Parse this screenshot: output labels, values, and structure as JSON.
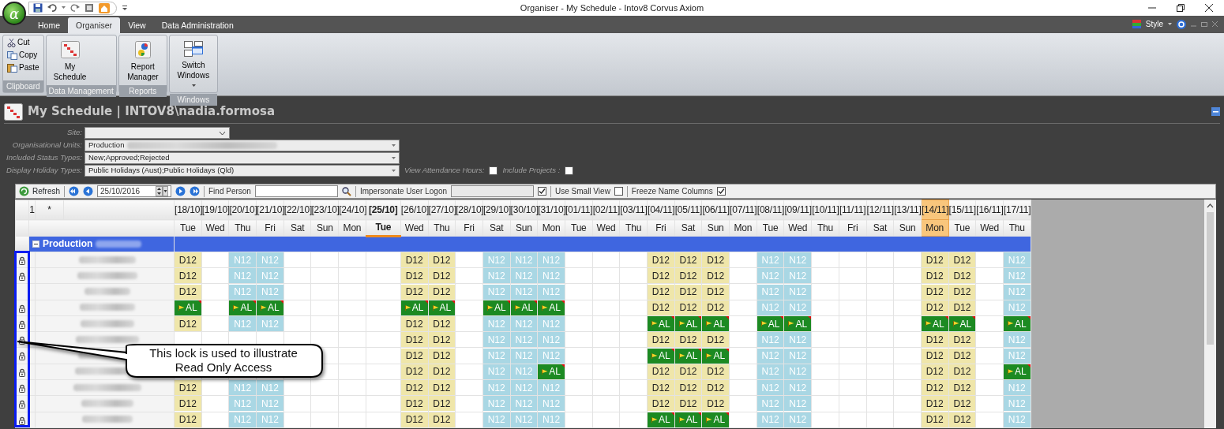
{
  "window": {
    "title": "Organiser - My Schedule - Intov8 Corvus Axiom",
    "logo": "α"
  },
  "ribbon_tabs": [
    {
      "label": "Home",
      "selected": false
    },
    {
      "label": "Organiser",
      "selected": true
    },
    {
      "label": "View",
      "selected": false
    },
    {
      "label": "Data Administration",
      "selected": false
    }
  ],
  "style_menu": {
    "label": "Style"
  },
  "ribbon_groups": [
    {
      "label": "Clipboard",
      "kind": "small",
      "buttons": [
        {
          "label": "Cut"
        },
        {
          "label": "Copy"
        },
        {
          "label": "Paste"
        }
      ]
    },
    {
      "label": "Data Management",
      "kind": "large",
      "buttons": [
        {
          "label": "My Schedule",
          "dropdown": false
        }
      ]
    },
    {
      "label": "Reports",
      "kind": "large",
      "buttons": [
        {
          "label": "Report Manager",
          "dropdown": false
        }
      ]
    },
    {
      "label": "Windows",
      "kind": "large",
      "buttons": [
        {
          "label": "Switch Windows",
          "dropdown": true
        }
      ]
    }
  ],
  "view": {
    "title": "My Schedule | INTOV8\\nadia.formosa"
  },
  "filters": [
    {
      "label": "Site:",
      "kind": "short"
    },
    {
      "label": "Organisational Units:",
      "kind": "long",
      "value": "Production",
      "redacted": true
    },
    {
      "label": "Included Status Types:",
      "kind": "long",
      "value": "New;Approved;Rejected",
      "redacted": false
    },
    {
      "label": "Display Holiday Types:",
      "kind": "long",
      "value": "Public Holidays (Aust);Public Holidays (Qld)",
      "redacted": false
    }
  ],
  "filter_options": [
    {
      "label": "View Attendance Hours:",
      "checked": false
    },
    {
      "label": "Include Projects :",
      "checked": false
    }
  ],
  "toolbar": {
    "refresh": "Refresh",
    "date": "25/10/2016",
    "find_label": "Find Person",
    "impersonate_label": "Impersonate User Logon",
    "impersonate_checked": true,
    "options": [
      {
        "label": "Use Small View",
        "checked": false
      },
      {
        "label": "Freeze Name Columns",
        "checked": true
      }
    ]
  },
  "grid": {
    "header_marks": [
      "1",
      "*"
    ],
    "columns": [
      {
        "date": "[18/10]",
        "day": "Tue",
        "today": false,
        "highlighted": false
      },
      {
        "date": "[19/10]",
        "day": "Wed",
        "today": false,
        "highlighted": false
      },
      {
        "date": "[20/10]",
        "day": "Thu",
        "today": false,
        "highlighted": false
      },
      {
        "date": "[21/10]",
        "day": "Fri",
        "today": false,
        "highlighted": false
      },
      {
        "date": "[22/10]",
        "day": "Sat",
        "today": false,
        "highlighted": false
      },
      {
        "date": "[23/10]",
        "day": "Sun",
        "today": false,
        "highlighted": false
      },
      {
        "date": "[24/10]",
        "day": "Mon",
        "today": false,
        "highlighted": false
      },
      {
        "date": "[25/10]",
        "day": "Tue",
        "today": true,
        "highlighted": false
      },
      {
        "date": "[26/10]",
        "day": "Wed",
        "today": false,
        "highlighted": false
      },
      {
        "date": "[27/10]",
        "day": "Thu",
        "today": false,
        "highlighted": false
      },
      {
        "date": "[28/10]",
        "day": "Fri",
        "today": false,
        "highlighted": false
      },
      {
        "date": "[29/10]",
        "day": "Sat",
        "today": false,
        "highlighted": false
      },
      {
        "date": "[30/10]",
        "day": "Sun",
        "today": false,
        "highlighted": false
      },
      {
        "date": "[31/10]",
        "day": "Mon",
        "today": false,
        "highlighted": false
      },
      {
        "date": "[01/11]",
        "day": "Tue",
        "today": false,
        "highlighted": false
      },
      {
        "date": "[02/11]",
        "day": "Wed",
        "today": false,
        "highlighted": false
      },
      {
        "date": "[03/11]",
        "day": "Thu",
        "today": false,
        "highlighted": false
      },
      {
        "date": "[04/11]",
        "day": "Fri",
        "today": false,
        "highlighted": false
      },
      {
        "date": "[05/11]",
        "day": "Sat",
        "today": false,
        "highlighted": false
      },
      {
        "date": "[06/11]",
        "day": "Sun",
        "today": false,
        "highlighted": false
      },
      {
        "date": "[07/11]",
        "day": "Mon",
        "today": false,
        "highlighted": false
      },
      {
        "date": "[08/11]",
        "day": "Tue",
        "today": false,
        "highlighted": false
      },
      {
        "date": "[09/11]",
        "day": "Wed",
        "today": false,
        "highlighted": false
      },
      {
        "date": "[10/11]",
        "day": "Thu",
        "today": false,
        "highlighted": false
      },
      {
        "date": "[11/11]",
        "day": "Fri",
        "today": false,
        "highlighted": false
      },
      {
        "date": "[12/11]",
        "day": "Sat",
        "today": false,
        "highlighted": false
      },
      {
        "date": "[13/11]",
        "day": "Sun",
        "today": false,
        "highlighted": false
      },
      {
        "date": "[14/11]",
        "day": "Mon",
        "today": false,
        "highlighted": true
      },
      {
        "date": "[15/11]",
        "day": "Tue",
        "today": false,
        "highlighted": false
      },
      {
        "date": "[16/11]",
        "day": "Wed",
        "today": false,
        "highlighted": false
      },
      {
        "date": "[17/11]",
        "day": "Thu",
        "today": false,
        "highlighted": false
      }
    ],
    "group": {
      "label": "Production",
      "expanded": true
    },
    "rows": [
      {
        "locked": true,
        "cells": [
          {
            "kind": "day",
            "text": "D12"
          },
          {
            "kind": "blank"
          },
          {
            "kind": "night",
            "text": "N12"
          },
          {
            "kind": "night",
            "text": "N12"
          },
          {
            "kind": "blank"
          },
          {
            "kind": "blank"
          },
          {
            "kind": "blank"
          },
          {
            "kind": "blank"
          },
          {
            "kind": "day",
            "text": "D12"
          },
          {
            "kind": "day",
            "text": "D12"
          },
          {
            "kind": "blank"
          },
          {
            "kind": "night",
            "text": "N12"
          },
          {
            "kind": "night",
            "text": "N12"
          },
          {
            "kind": "night",
            "text": "N12"
          },
          {
            "kind": "blank"
          },
          {
            "kind": "blank"
          },
          {
            "kind": "blank"
          },
          {
            "kind": "day",
            "text": "D12"
          },
          {
            "kind": "day",
            "text": "D12"
          },
          {
            "kind": "day",
            "text": "D12"
          },
          {
            "kind": "blank"
          },
          {
            "kind": "night",
            "text": "N12"
          },
          {
            "kind": "night",
            "text": "N12"
          },
          {
            "kind": "blank"
          },
          {
            "kind": "blank"
          },
          {
            "kind": "blank"
          },
          {
            "kind": "blank"
          },
          {
            "kind": "day",
            "text": "D12"
          },
          {
            "kind": "day",
            "text": "D12"
          },
          {
            "kind": "blank"
          },
          {
            "kind": "night",
            "text": "N12"
          }
        ]
      },
      {
        "locked": true,
        "cells": [
          {
            "kind": "day",
            "text": "D12"
          },
          {
            "kind": "blank"
          },
          {
            "kind": "night",
            "text": "N12"
          },
          {
            "kind": "night",
            "text": "N12"
          },
          {
            "kind": "blank"
          },
          {
            "kind": "blank"
          },
          {
            "kind": "blank"
          },
          {
            "kind": "blank"
          },
          {
            "kind": "day",
            "text": "D12"
          },
          {
            "kind": "day",
            "text": "D12"
          },
          {
            "kind": "blank"
          },
          {
            "kind": "night",
            "text": "N12"
          },
          {
            "kind": "night",
            "text": "N12"
          },
          {
            "kind": "night",
            "text": "N12"
          },
          {
            "kind": "blank"
          },
          {
            "kind": "blank"
          },
          {
            "kind": "blank"
          },
          {
            "kind": "day",
            "text": "D12"
          },
          {
            "kind": "day",
            "text": "D12"
          },
          {
            "kind": "day",
            "text": "D12"
          },
          {
            "kind": "blank"
          },
          {
            "kind": "night",
            "text": "N12"
          },
          {
            "kind": "night",
            "text": "N12"
          },
          {
            "kind": "blank"
          },
          {
            "kind": "blank"
          },
          {
            "kind": "blank"
          },
          {
            "kind": "blank"
          },
          {
            "kind": "day",
            "text": "D12"
          },
          {
            "kind": "day",
            "text": "D12"
          },
          {
            "kind": "blank"
          },
          {
            "kind": "night",
            "text": "N12"
          }
        ]
      },
      {
        "locked": false,
        "cells": [
          {
            "kind": "day",
            "text": "D12"
          },
          {
            "kind": "blank"
          },
          {
            "kind": "night",
            "text": "N12"
          },
          {
            "kind": "night",
            "text": "N12"
          },
          {
            "kind": "blank"
          },
          {
            "kind": "blank"
          },
          {
            "kind": "blank"
          },
          {
            "kind": "blank"
          },
          {
            "kind": "day",
            "text": "D12"
          },
          {
            "kind": "day",
            "text": "D12"
          },
          {
            "kind": "blank"
          },
          {
            "kind": "night",
            "text": "N12"
          },
          {
            "kind": "night",
            "text": "N12"
          },
          {
            "kind": "night",
            "text": "N12"
          },
          {
            "kind": "blank"
          },
          {
            "kind": "blank"
          },
          {
            "kind": "blank"
          },
          {
            "kind": "day",
            "text": "D12"
          },
          {
            "kind": "day",
            "text": "D12"
          },
          {
            "kind": "day",
            "text": "D12"
          },
          {
            "kind": "blank"
          },
          {
            "kind": "night",
            "text": "N12"
          },
          {
            "kind": "night",
            "text": "N12"
          },
          {
            "kind": "blank"
          },
          {
            "kind": "blank"
          },
          {
            "kind": "blank"
          },
          {
            "kind": "blank"
          },
          {
            "kind": "day",
            "text": "D12"
          },
          {
            "kind": "day",
            "text": "D12"
          },
          {
            "kind": "blank"
          },
          {
            "kind": "night",
            "text": "N12"
          }
        ]
      },
      {
        "locked": true,
        "cells": [
          {
            "kind": "leave",
            "text": "AL"
          },
          {
            "kind": "blank"
          },
          {
            "kind": "leave",
            "text": "AL"
          },
          {
            "kind": "leave",
            "text": "AL"
          },
          {
            "kind": "blank"
          },
          {
            "kind": "blank"
          },
          {
            "kind": "blank"
          },
          {
            "kind": "blank"
          },
          {
            "kind": "leave",
            "text": "AL"
          },
          {
            "kind": "leave",
            "text": "AL"
          },
          {
            "kind": "blank"
          },
          {
            "kind": "leave",
            "text": "AL"
          },
          {
            "kind": "leave",
            "text": "AL"
          },
          {
            "kind": "leave",
            "text": "AL"
          },
          {
            "kind": "blank"
          },
          {
            "kind": "blank"
          },
          {
            "kind": "blank"
          },
          {
            "kind": "day",
            "text": "D12"
          },
          {
            "kind": "day",
            "text": "D12"
          },
          {
            "kind": "day",
            "text": "D12"
          },
          {
            "kind": "blank"
          },
          {
            "kind": "night",
            "text": "N12"
          },
          {
            "kind": "night",
            "text": "N12"
          },
          {
            "kind": "blank"
          },
          {
            "kind": "blank"
          },
          {
            "kind": "blank"
          },
          {
            "kind": "blank"
          },
          {
            "kind": "day",
            "text": "D12"
          },
          {
            "kind": "day",
            "text": "D12"
          },
          {
            "kind": "blank"
          },
          {
            "kind": "night",
            "text": "N12"
          }
        ]
      },
      {
        "locked": true,
        "cells": [
          {
            "kind": "day",
            "text": "D12"
          },
          {
            "kind": "blank"
          },
          {
            "kind": "night",
            "text": "N12"
          },
          {
            "kind": "night",
            "text": "N12"
          },
          {
            "kind": "blank"
          },
          {
            "kind": "blank"
          },
          {
            "kind": "blank"
          },
          {
            "kind": "blank"
          },
          {
            "kind": "day",
            "text": "D12"
          },
          {
            "kind": "day",
            "text": "D12"
          },
          {
            "kind": "blank"
          },
          {
            "kind": "night",
            "text": "N12"
          },
          {
            "kind": "night",
            "text": "N12"
          },
          {
            "kind": "night",
            "text": "N12"
          },
          {
            "kind": "blank"
          },
          {
            "kind": "blank"
          },
          {
            "kind": "blank"
          },
          {
            "kind": "leave",
            "text": "AL"
          },
          {
            "kind": "leave",
            "text": "AL"
          },
          {
            "kind": "leave",
            "text": "AL"
          },
          {
            "kind": "blank"
          },
          {
            "kind": "leave",
            "text": "AL"
          },
          {
            "kind": "leave",
            "text": "AL"
          },
          {
            "kind": "blank"
          },
          {
            "kind": "blank"
          },
          {
            "kind": "blank"
          },
          {
            "kind": "blank"
          },
          {
            "kind": "leave",
            "text": "AL"
          },
          {
            "kind": "leave",
            "text": "AL"
          },
          {
            "kind": "blank"
          },
          {
            "kind": "leave",
            "text": "AL"
          }
        ]
      },
      {
        "locked": true,
        "cells": [
          {
            "kind": "blank"
          },
          {
            "kind": "blank"
          },
          {
            "kind": "blank"
          },
          {
            "kind": "blank"
          },
          {
            "kind": "blank"
          },
          {
            "kind": "blank"
          },
          {
            "kind": "blank"
          },
          {
            "kind": "blank"
          },
          {
            "kind": "day",
            "text": "D12"
          },
          {
            "kind": "day",
            "text": "D12"
          },
          {
            "kind": "blank"
          },
          {
            "kind": "night",
            "text": "N12"
          },
          {
            "kind": "night",
            "text": "N12"
          },
          {
            "kind": "night",
            "text": "N12"
          },
          {
            "kind": "blank"
          },
          {
            "kind": "blank"
          },
          {
            "kind": "blank"
          },
          {
            "kind": "day",
            "text": "D12"
          },
          {
            "kind": "day",
            "text": "D12"
          },
          {
            "kind": "day",
            "text": "D12"
          },
          {
            "kind": "blank"
          },
          {
            "kind": "night",
            "text": "N12"
          },
          {
            "kind": "night",
            "text": "N12"
          },
          {
            "kind": "blank"
          },
          {
            "kind": "blank"
          },
          {
            "kind": "blank"
          },
          {
            "kind": "blank"
          },
          {
            "kind": "day",
            "text": "D12"
          },
          {
            "kind": "day",
            "text": "D12"
          },
          {
            "kind": "blank"
          },
          {
            "kind": "night",
            "text": "N12"
          }
        ]
      },
      {
        "locked": true,
        "cells": [
          {
            "kind": "blank"
          },
          {
            "kind": "blank"
          },
          {
            "kind": "blank"
          },
          {
            "kind": "blank"
          },
          {
            "kind": "blank"
          },
          {
            "kind": "blank"
          },
          {
            "kind": "blank"
          },
          {
            "kind": "blank"
          },
          {
            "kind": "day",
            "text": "D12"
          },
          {
            "kind": "day",
            "text": "D12"
          },
          {
            "kind": "blank"
          },
          {
            "kind": "night",
            "text": "N12"
          },
          {
            "kind": "night",
            "text": "N12"
          },
          {
            "kind": "night",
            "text": "N12"
          },
          {
            "kind": "blank"
          },
          {
            "kind": "blank"
          },
          {
            "kind": "blank"
          },
          {
            "kind": "leave",
            "text": "AL"
          },
          {
            "kind": "leave",
            "text": "AL"
          },
          {
            "kind": "leave",
            "text": "AL"
          },
          {
            "kind": "blank"
          },
          {
            "kind": "night",
            "text": "N12"
          },
          {
            "kind": "night",
            "text": "N12"
          },
          {
            "kind": "blank"
          },
          {
            "kind": "blank"
          },
          {
            "kind": "blank"
          },
          {
            "kind": "blank"
          },
          {
            "kind": "day",
            "text": "D12"
          },
          {
            "kind": "day",
            "text": "D12"
          },
          {
            "kind": "blank"
          },
          {
            "kind": "night",
            "text": "N12"
          }
        ]
      },
      {
        "locked": true,
        "cells": [
          {
            "kind": "blank"
          },
          {
            "kind": "blank"
          },
          {
            "kind": "blank"
          },
          {
            "kind": "blank"
          },
          {
            "kind": "blank"
          },
          {
            "kind": "blank"
          },
          {
            "kind": "blank"
          },
          {
            "kind": "blank"
          },
          {
            "kind": "day",
            "text": "D12"
          },
          {
            "kind": "day",
            "text": "D12"
          },
          {
            "kind": "blank"
          },
          {
            "kind": "night",
            "text": "N12"
          },
          {
            "kind": "night",
            "text": "N12"
          },
          {
            "kind": "leave",
            "text": "AL"
          },
          {
            "kind": "blank"
          },
          {
            "kind": "blank"
          },
          {
            "kind": "blank"
          },
          {
            "kind": "day",
            "text": "D12"
          },
          {
            "kind": "day",
            "text": "D12"
          },
          {
            "kind": "day",
            "text": "D12"
          },
          {
            "kind": "blank"
          },
          {
            "kind": "night",
            "text": "N12"
          },
          {
            "kind": "night",
            "text": "N12"
          },
          {
            "kind": "blank"
          },
          {
            "kind": "blank"
          },
          {
            "kind": "blank"
          },
          {
            "kind": "blank"
          },
          {
            "kind": "day",
            "text": "D12"
          },
          {
            "kind": "day",
            "text": "D12"
          },
          {
            "kind": "blank"
          },
          {
            "kind": "leave",
            "text": "AL"
          }
        ]
      },
      {
        "locked": true,
        "cells": [
          {
            "kind": "day",
            "text": "D12"
          },
          {
            "kind": "blank"
          },
          {
            "kind": "night",
            "text": "N12"
          },
          {
            "kind": "night",
            "text": "N12"
          },
          {
            "kind": "blank"
          },
          {
            "kind": "blank"
          },
          {
            "kind": "blank"
          },
          {
            "kind": "blank"
          },
          {
            "kind": "day",
            "text": "D12"
          },
          {
            "kind": "day",
            "text": "D12"
          },
          {
            "kind": "blank"
          },
          {
            "kind": "night",
            "text": "N12"
          },
          {
            "kind": "night",
            "text": "N12"
          },
          {
            "kind": "night",
            "text": "N12"
          },
          {
            "kind": "blank"
          },
          {
            "kind": "blank"
          },
          {
            "kind": "blank"
          },
          {
            "kind": "day",
            "text": "D12"
          },
          {
            "kind": "day",
            "text": "D12"
          },
          {
            "kind": "day",
            "text": "D12"
          },
          {
            "kind": "blank"
          },
          {
            "kind": "night",
            "text": "N12"
          },
          {
            "kind": "night",
            "text": "N12"
          },
          {
            "kind": "blank"
          },
          {
            "kind": "blank"
          },
          {
            "kind": "blank"
          },
          {
            "kind": "blank"
          },
          {
            "kind": "day",
            "text": "D12"
          },
          {
            "kind": "day",
            "text": "D12"
          },
          {
            "kind": "blank"
          },
          {
            "kind": "night",
            "text": "N12"
          }
        ]
      },
      {
        "locked": true,
        "cells": [
          {
            "kind": "day",
            "text": "D12"
          },
          {
            "kind": "blank"
          },
          {
            "kind": "night",
            "text": "N12"
          },
          {
            "kind": "night",
            "text": "N12"
          },
          {
            "kind": "blank"
          },
          {
            "kind": "blank"
          },
          {
            "kind": "blank"
          },
          {
            "kind": "blank"
          },
          {
            "kind": "day",
            "text": "D12"
          },
          {
            "kind": "day",
            "text": "D12"
          },
          {
            "kind": "blank"
          },
          {
            "kind": "night",
            "text": "N12"
          },
          {
            "kind": "night",
            "text": "N12"
          },
          {
            "kind": "night",
            "text": "N12"
          },
          {
            "kind": "blank"
          },
          {
            "kind": "blank"
          },
          {
            "kind": "blank"
          },
          {
            "kind": "day",
            "text": "D12"
          },
          {
            "kind": "day",
            "text": "D12"
          },
          {
            "kind": "day",
            "text": "D12"
          },
          {
            "kind": "blank"
          },
          {
            "kind": "night",
            "text": "N12"
          },
          {
            "kind": "night",
            "text": "N12"
          },
          {
            "kind": "blank"
          },
          {
            "kind": "blank"
          },
          {
            "kind": "blank"
          },
          {
            "kind": "blank"
          },
          {
            "kind": "day",
            "text": "D12"
          },
          {
            "kind": "day",
            "text": "D12"
          },
          {
            "kind": "blank"
          },
          {
            "kind": "night",
            "text": "N12"
          }
        ]
      },
      {
        "locked": true,
        "cells": [
          {
            "kind": "day",
            "text": "D12"
          },
          {
            "kind": "blank"
          },
          {
            "kind": "night",
            "text": "N12"
          },
          {
            "kind": "night",
            "text": "N12"
          },
          {
            "kind": "blank"
          },
          {
            "kind": "blank"
          },
          {
            "kind": "blank"
          },
          {
            "kind": "blank"
          },
          {
            "kind": "day",
            "text": "D12"
          },
          {
            "kind": "day",
            "text": "D12"
          },
          {
            "kind": "blank"
          },
          {
            "kind": "night",
            "text": "N12"
          },
          {
            "kind": "night",
            "text": "N12"
          },
          {
            "kind": "night",
            "text": "N12"
          },
          {
            "kind": "blank"
          },
          {
            "kind": "blank"
          },
          {
            "kind": "blank"
          },
          {
            "kind": "leave",
            "text": "AL"
          },
          {
            "kind": "leave",
            "text": "AL"
          },
          {
            "kind": "leave",
            "text": "AL"
          },
          {
            "kind": "blank"
          },
          {
            "kind": "night",
            "text": "N12"
          },
          {
            "kind": "night",
            "text": "N12"
          },
          {
            "kind": "blank"
          },
          {
            "kind": "blank"
          },
          {
            "kind": "blank"
          },
          {
            "kind": "blank"
          },
          {
            "kind": "day",
            "text": "D12"
          },
          {
            "kind": "day",
            "text": "D12"
          },
          {
            "kind": "blank"
          },
          {
            "kind": "night",
            "text": "N12"
          }
        ]
      }
    ]
  },
  "callout": {
    "lines": [
      "This lock is used to illustrate",
      "Read Only Access"
    ]
  }
}
